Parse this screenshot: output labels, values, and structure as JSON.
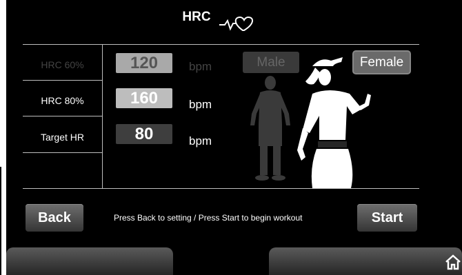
{
  "header": {
    "title": "HRC",
    "icon": "heart-pulse-icon"
  },
  "rows": [
    {
      "label": "HRC 60%",
      "value": "120",
      "unit": "bpm"
    },
    {
      "label": "HRC 80%",
      "value": "160",
      "unit": "bpm"
    },
    {
      "label": "Target HR",
      "value": "80",
      "unit": "bpm"
    }
  ],
  "gender": {
    "male_label": "Male",
    "female_label": "Female",
    "selected": "Female"
  },
  "footer": {
    "back_label": "Back",
    "hint": "Press Back to setting / Press Start to begin workout",
    "start_label": "Start"
  },
  "colors": {
    "background": "#000000",
    "button": "#5a5a5a",
    "line": "#bfbfbf"
  }
}
